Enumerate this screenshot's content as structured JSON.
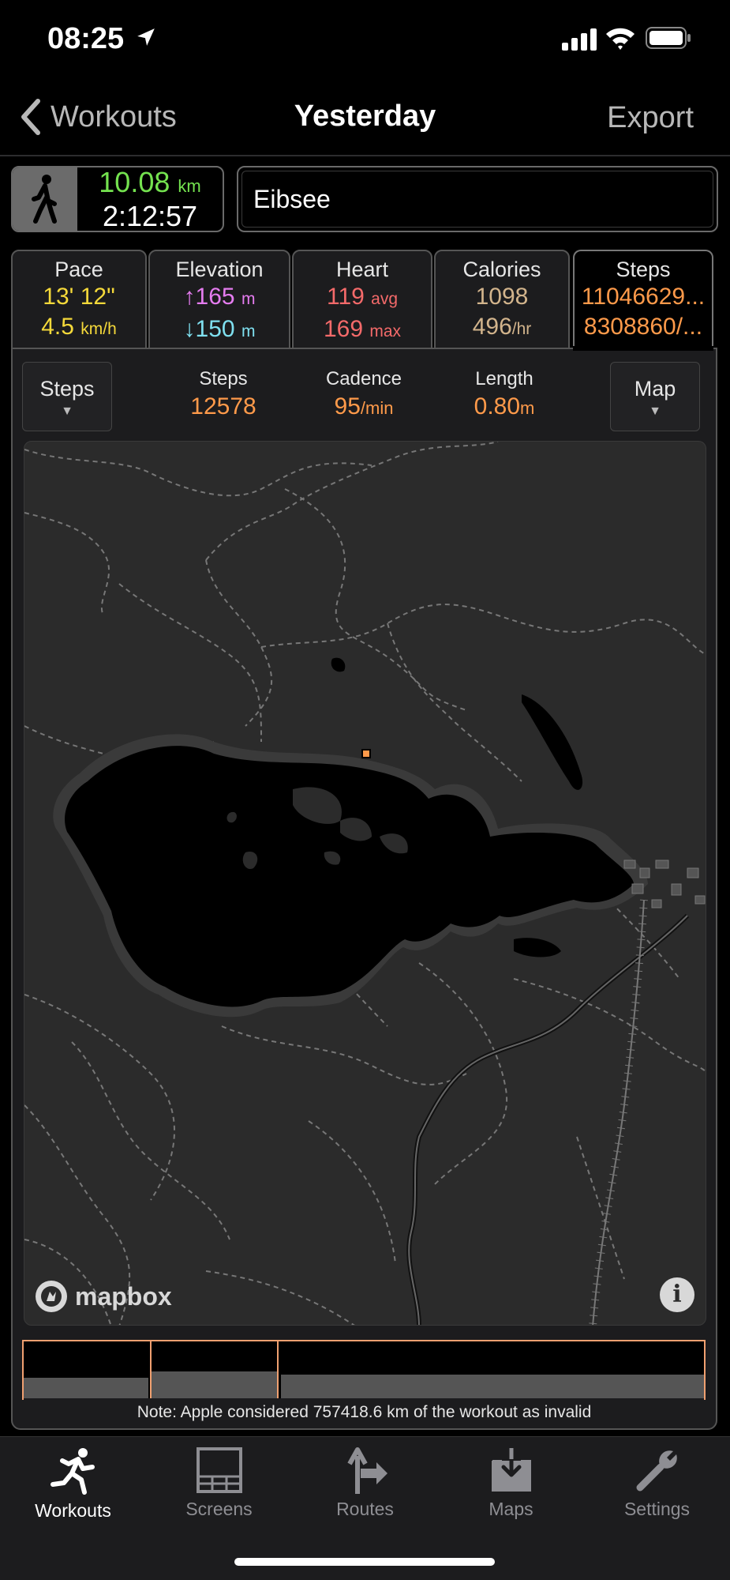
{
  "status_bar": {
    "time": "08:25"
  },
  "nav": {
    "back_label": "Workouts",
    "title": "Yesterday",
    "export_label": "Export"
  },
  "summary": {
    "distance": "10.08",
    "distance_unit": "km",
    "duration": "2:12:57"
  },
  "workout_name": "Eibsee",
  "metric_tabs": [
    {
      "label": "Pace",
      "line1": "13' 12\"",
      "line1_unit": "",
      "line2": "4.5",
      "line2_unit": "km/h",
      "color": "#f5d93a"
    },
    {
      "label": "Elevation",
      "line1": "↑165",
      "line1_unit": "m",
      "line2": "↓150",
      "line2_unit": "m",
      "color1": "#e57cf0",
      "color2": "#7fe0f0"
    },
    {
      "label": "Heart",
      "line1": "119",
      "line1_unit": "avg",
      "line2": "169",
      "line2_unit": "max",
      "color": "#f46a6a"
    },
    {
      "label": "Calories",
      "line1": "1098",
      "line1_unit": "",
      "line2": "496",
      "line2_unit": "/hr",
      "color": "#d2b48c"
    },
    {
      "label": "Steps",
      "line1": "11046629...",
      "line1_unit": "",
      "line2": "8308860/...",
      "line2_unit": "",
      "color": "#ff9a4a"
    }
  ],
  "panel": {
    "left_button": "Steps",
    "right_button": "Map",
    "stats": [
      {
        "label": "Steps",
        "value": "12578",
        "unit": ""
      },
      {
        "label": "Cadence",
        "value": "95",
        "unit": "/min"
      },
      {
        "label": "Length",
        "value": "0.80",
        "unit": "m"
      }
    ],
    "map_attribution": "mapbox",
    "note": "Note: Apple considered 757418.6 km of the workout as invalid"
  },
  "tabbar": [
    {
      "label": "Workouts",
      "icon": "runner-icon",
      "active": true
    },
    {
      "label": "Screens",
      "icon": "screens-icon",
      "active": false
    },
    {
      "label": "Routes",
      "icon": "route-sign-icon",
      "active": false
    },
    {
      "label": "Maps",
      "icon": "download-tray-icon",
      "active": false
    },
    {
      "label": "Settings",
      "icon": "wrench-icon",
      "active": false
    }
  ],
  "colors": {
    "accent_orange": "#ff9a4a",
    "distance_green": "#74e24f",
    "timeline_border": "#f0a070"
  }
}
